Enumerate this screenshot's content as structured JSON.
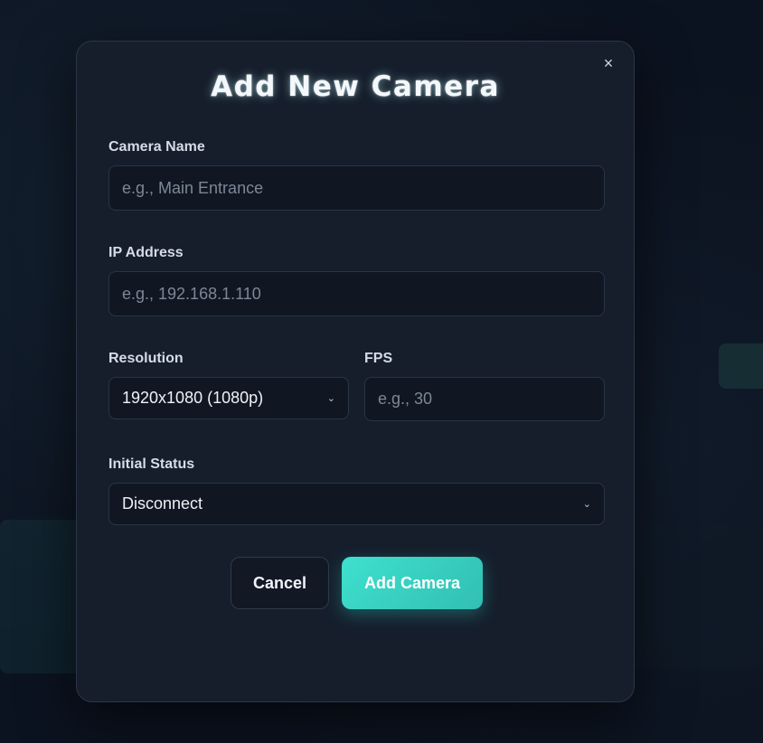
{
  "modal": {
    "title": "Add New Camera",
    "close_icon": "×",
    "fields": {
      "camera_name": {
        "label": "Camera Name",
        "value": "",
        "placeholder": "e.g., Main Entrance"
      },
      "ip_address": {
        "label": "IP Address",
        "value": "",
        "placeholder": "e.g., 192.168.1.110"
      },
      "resolution": {
        "label": "Resolution",
        "selected": "1920x1080 (1080p)"
      },
      "fps": {
        "label": "FPS",
        "value": "",
        "placeholder": "e.g., 30"
      },
      "initial_status": {
        "label": "Initial Status",
        "selected": "Disconnect"
      }
    },
    "chevron_icon": "⌄",
    "buttons": {
      "cancel_label": "Cancel",
      "add_label": "Add Camera"
    }
  },
  "colors": {
    "accent": "#3ee0cf",
    "modal_bg": "#161e2c",
    "page_bg": "#0c1320"
  }
}
